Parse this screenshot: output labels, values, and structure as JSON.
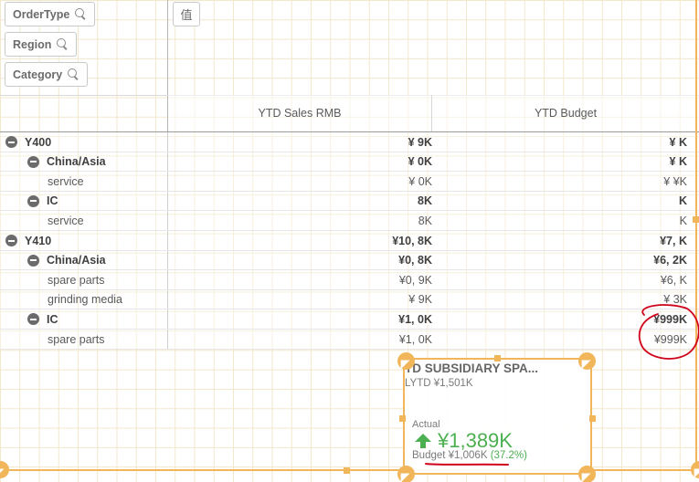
{
  "filters": {
    "chips": [
      {
        "label": "OrderType"
      },
      {
        "label": "Region"
      },
      {
        "label": "Category"
      }
    ],
    "values_chip": "值"
  },
  "pivot": {
    "columns": [
      "YTD Sales RMB",
      "YTD Budget"
    ],
    "rows": [
      {
        "label": "Y400",
        "sales": "¥ 9K",
        "budget": "¥ K",
        "bold": true
      },
      {
        "label": "China/Asia",
        "sales": "¥ 0K",
        "budget": "¥ K",
        "bold": true
      },
      {
        "label": "service",
        "sales": "¥ 0K",
        "budget": "¥ ¥K",
        "bold": false
      },
      {
        "label": "IC",
        "sales": "8K",
        "budget": "K",
        "bold": true
      },
      {
        "label": "service",
        "sales": "8K",
        "budget": "K",
        "bold": false
      },
      {
        "label": "Y410",
        "sales": "¥10, 8K",
        "budget": "¥7, K",
        "bold": true
      },
      {
        "label": "China/Asia",
        "sales": "¥0, 8K",
        "budget": "¥6, 2K",
        "bold": true
      },
      {
        "label": "spare parts",
        "sales": "¥0, 9K",
        "budget": "¥6, K",
        "bold": false
      },
      {
        "label": "grinding media",
        "sales": "¥ 9K",
        "budget": "¥ 3K",
        "bold": false
      },
      {
        "label": "IC",
        "sales": "¥1, 0K",
        "budget": "¥999K",
        "bold": true
      },
      {
        "label": "spare parts",
        "sales": "¥1, 0K",
        "budget": "¥999K",
        "bold": false
      }
    ]
  },
  "kpi": {
    "title": "TD SUBSIDIARY SPA...",
    "subtitle": "LYTD ¥1,501K",
    "actual_label": "Actual",
    "actual_value": "¥1,389K",
    "budget_text": "Budget ¥1,006K",
    "budget_pct": "(37.2%)"
  },
  "colors": {
    "accent": "#f2b65a",
    "positive": "#4caf50",
    "annotation": "#d0021b"
  },
  "icons": [
    "search-icon",
    "collapse-icon",
    "arrow-up-icon",
    "resize-handle-icon"
  ]
}
